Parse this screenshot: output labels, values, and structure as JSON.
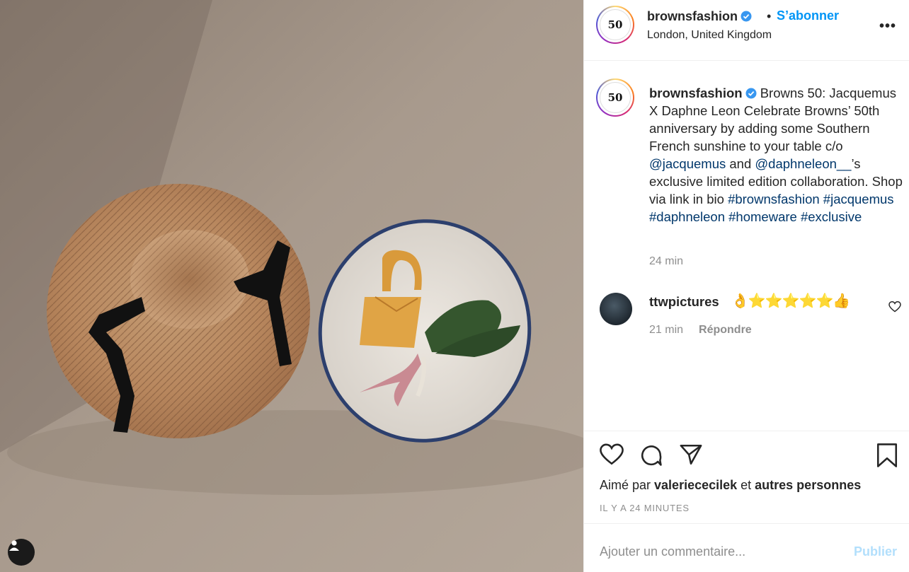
{
  "post": {
    "username": "brownsfashion",
    "follow_label": "S’abonner",
    "separator": "•",
    "location": "London, United Kingdom",
    "more_label": "•••",
    "avatar_text": "50"
  },
  "caption": {
    "username": "brownsfashion",
    "text_1": "Browns 50: Jacquemus X Daphne Leon Celebrate Browns’ 50th anniversary by adding some Southern French sunshine to your table c/o ",
    "mention_1": "@jacquemus",
    "text_2": " and ",
    "mention_2": "@daphneleon__",
    "text_3": "’s exclusive limited edition collaboration. Shop via link in bio ",
    "tag_1": "#brownsfashion",
    "tag_2": "#jacquemus",
    "tag_3": "#daphneleon",
    "tag_4": "#homeware",
    "tag_5": "#exclusive",
    "time": "24 min"
  },
  "comment": {
    "username": "ttwpictures",
    "text": "👌⭐⭐⭐⭐⭐👍",
    "time": "21 min",
    "reply_label": "Répondre"
  },
  "likes": {
    "prefix": "Aimé par ",
    "user": "valeriececilek",
    "middle": " et ",
    "rest": "autres personnes"
  },
  "timestamp": "IL Y A 24 MINUTES",
  "comment_input": {
    "placeholder": "Ajouter un commentaire...",
    "publish_label": "Publier"
  },
  "colors": {
    "accent": "#0095f6",
    "link": "#00376b",
    "muted": "#8e8e8e",
    "publish_disabled": "#b2dffc"
  }
}
